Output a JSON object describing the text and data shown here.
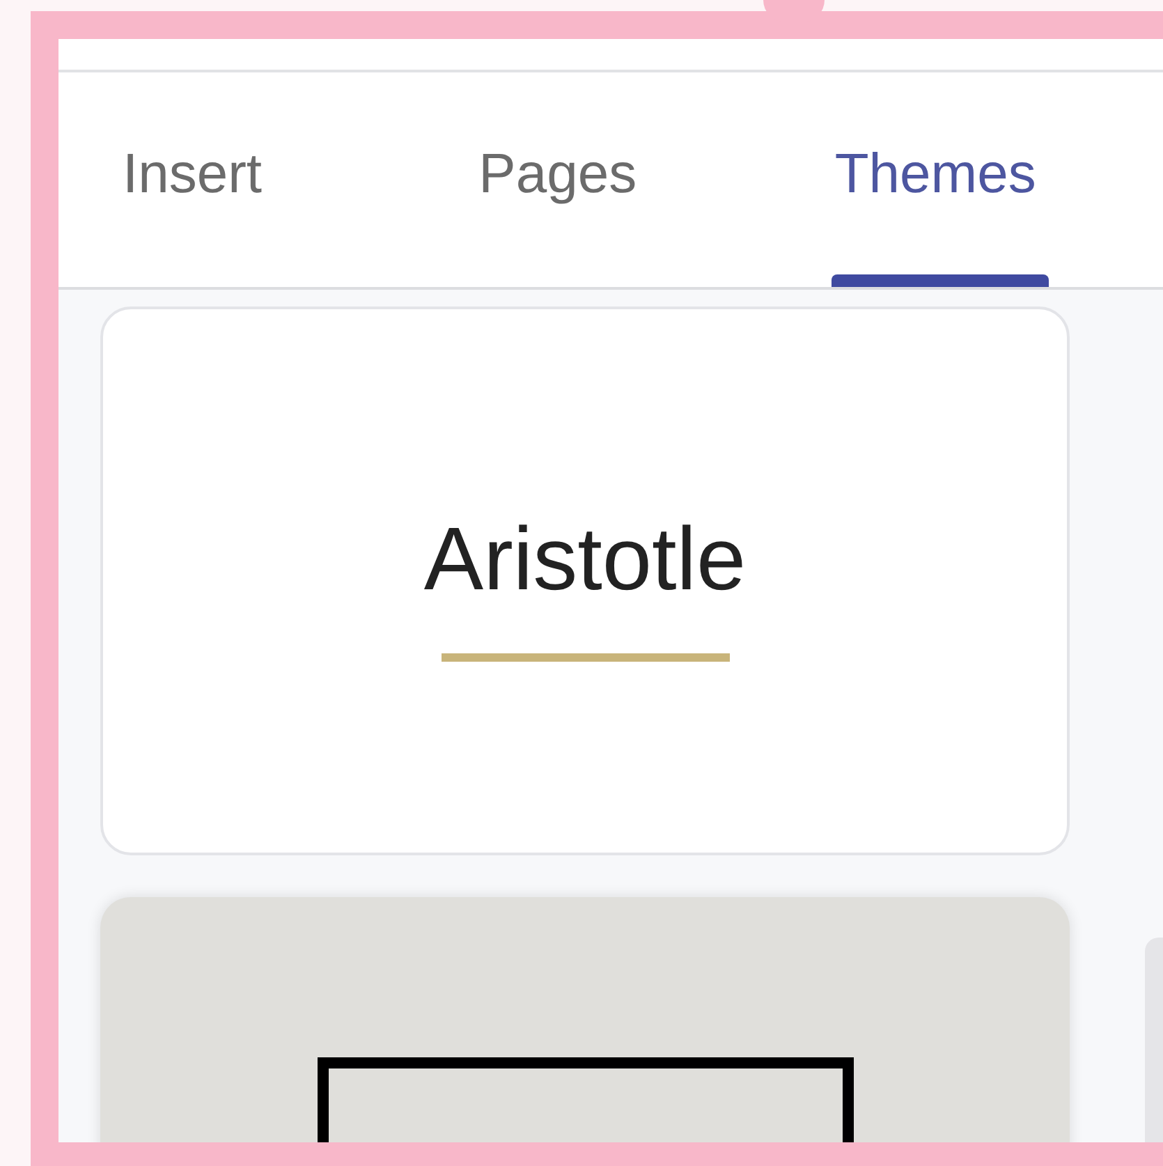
{
  "tabs": [
    {
      "label": "Insert",
      "selected": false
    },
    {
      "label": "Pages",
      "selected": false
    },
    {
      "label": "Themes",
      "selected": true
    }
  ],
  "themes": [
    {
      "kind": "underline",
      "name": "Aristotle"
    },
    {
      "kind": "framed"
    }
  ]
}
